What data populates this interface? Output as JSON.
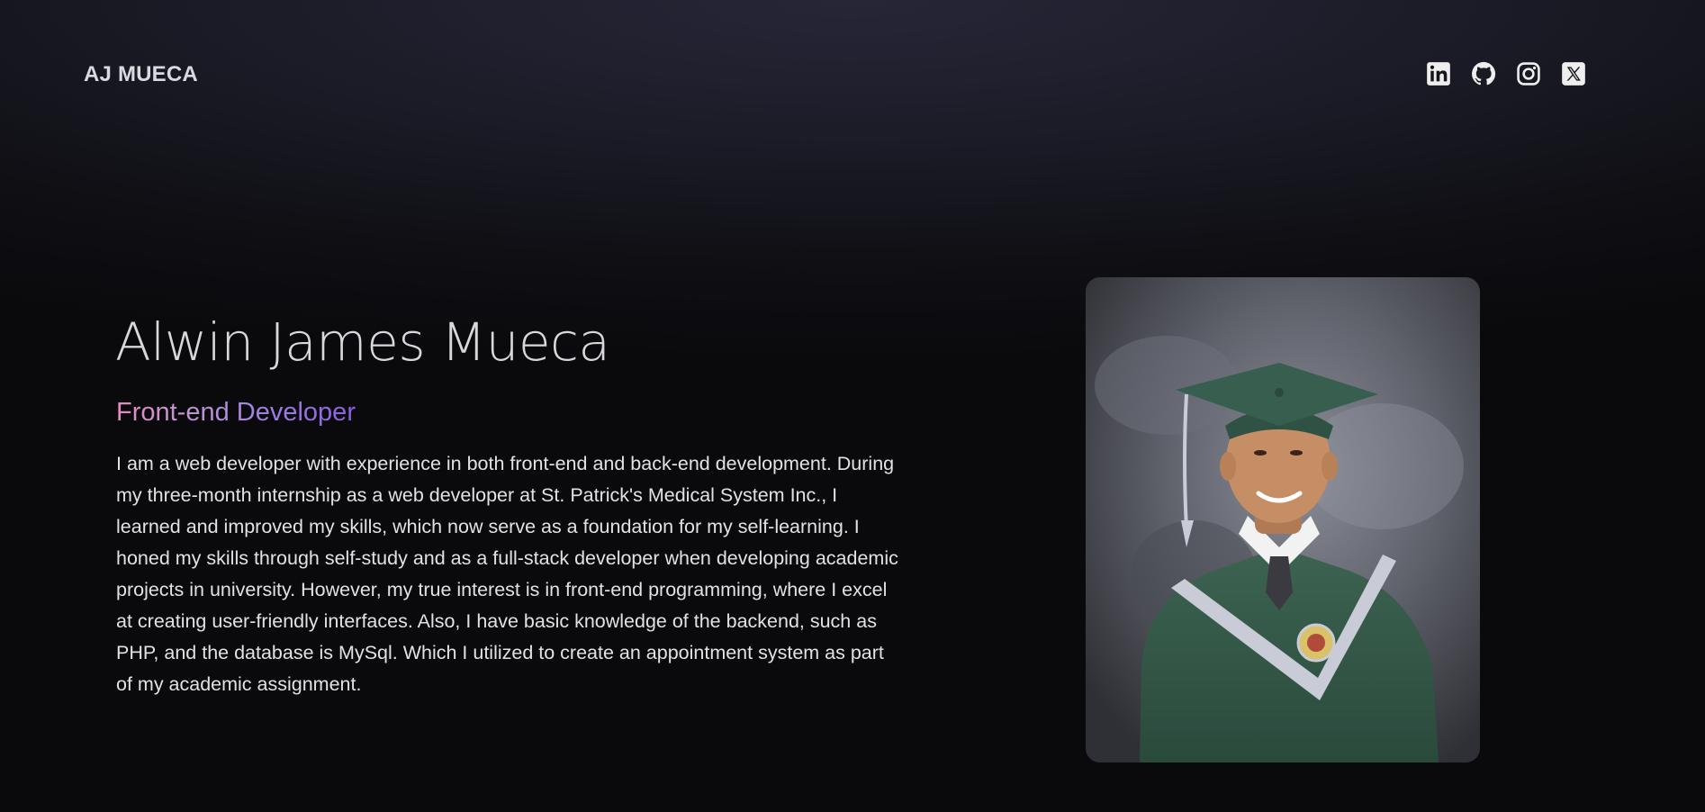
{
  "header": {
    "brand": "AJ MUECA",
    "social": [
      {
        "icon": "linkedin-icon",
        "label": "LinkedIn"
      },
      {
        "icon": "github-icon",
        "label": "GitHub"
      },
      {
        "icon": "instagram-icon",
        "label": "Instagram"
      },
      {
        "icon": "x-twitter-icon",
        "label": "X"
      }
    ]
  },
  "hero": {
    "name": "Alwin James Mueca",
    "role": "Front-end Developer",
    "bio": "I am a web developer with experience in both front-end and back-end development. During my three-month internship as a web developer at St. Patrick's Medical System Inc., I learned and improved my skills, which now serve as a foundation for my self-learning. I honed my skills through self-study and as a full-stack developer when developing academic projects in university. However, my true interest is in front-end programming, where I excel at creating user-friendly interfaces. Also, I have basic knowledge of the backend, such as PHP, and the database is MySql. Which I utilized to create an appointment system as part of my academic assignment."
  },
  "colors": {
    "background": "#0c0c10",
    "role_gradient_start": "#e58bc0",
    "role_gradient_end": "#8a5fe0",
    "text": "#e2e2e6"
  }
}
